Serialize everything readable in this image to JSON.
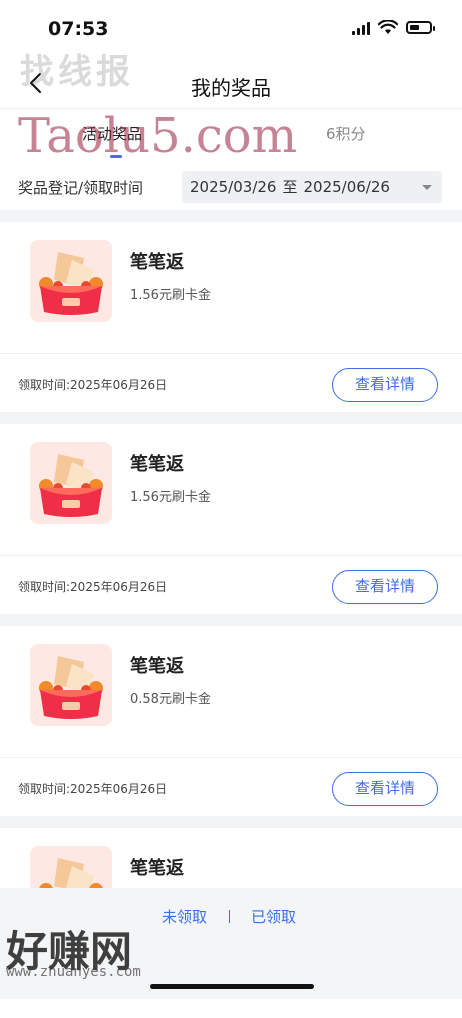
{
  "status_bar": {
    "time": "07:53"
  },
  "navbar": {
    "title": "我的奖品"
  },
  "tabs": [
    {
      "label": "活动奖品",
      "active": true
    },
    {
      "label": "6积分",
      "active": false
    }
  ],
  "date_filter": {
    "label": "奖品登记/领取时间",
    "start": "2025/03/26",
    "separator": "至",
    "end": "2025/06/26"
  },
  "prizes": [
    {
      "title": "笔笔返",
      "amount": "1.56元刷卡金",
      "claim_time": "领取时间:2025年06月26日",
      "detail_label": "查看详情"
    },
    {
      "title": "笔笔返",
      "amount": "1.56元刷卡金",
      "claim_time": "领取时间:2025年06月26日",
      "detail_label": "查看详情"
    },
    {
      "title": "笔笔返",
      "amount": "0.58元刷卡金",
      "claim_time": "领取时间:2025年06月26日",
      "detail_label": "查看详情"
    },
    {
      "title": "笔笔返"
    }
  ],
  "bottom_tabs": {
    "unclaimed": "未领取",
    "claimed": "已领取"
  },
  "watermarks": {
    "top": "找线报",
    "taolu": "Taolu5.com",
    "bottom": "好赚网",
    "url": "www.zhuanyes.com"
  },
  "colors": {
    "accent": "#3d6ee8",
    "background": "#f2f3f5"
  }
}
